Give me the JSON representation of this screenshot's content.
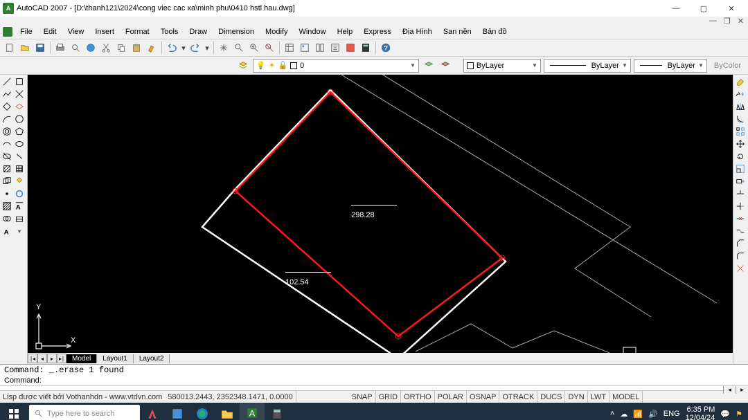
{
  "app": {
    "name": "AutoCAD 2007",
    "file": "[D:\\thanh121\\2024\\cong viec cac xa\\minh phu\\0410 hstl hau.dwg]"
  },
  "menus": [
    "File",
    "Edit",
    "View",
    "Insert",
    "Format",
    "Tools",
    "Draw",
    "Dimension",
    "Modify",
    "Window",
    "Help",
    "Express",
    "Địa Hình",
    "San nền",
    "Bản đồ"
  ],
  "layer": {
    "current": "0",
    "bylayer": "ByLayer",
    "bycolor": "ByColor"
  },
  "dims": {
    "a": "298.28",
    "b": "102.54"
  },
  "ucs": {
    "x": "X",
    "y": "Y"
  },
  "tabs": {
    "model": "Model",
    "l1": "Layout1",
    "l2": "Layout2"
  },
  "cmd": {
    "line1": "Command: _.erase 1 found",
    "line2": "Command:"
  },
  "status": {
    "credit": "Lisp được viết bởi Vothanhdn - www.vtdvn.com",
    "coords": "580013.2443, 2352348.1471, 0.0000",
    "toggles": [
      "SNAP",
      "GRID",
      "ORTHO",
      "POLAR",
      "OSNAP",
      "OTRACK",
      "DUCS",
      "DYN",
      "LWT",
      "MODEL"
    ]
  },
  "taskbar": {
    "search": "Type here to search",
    "lang": "ENG",
    "time": "6:35 PM",
    "date": "12/04/24"
  }
}
